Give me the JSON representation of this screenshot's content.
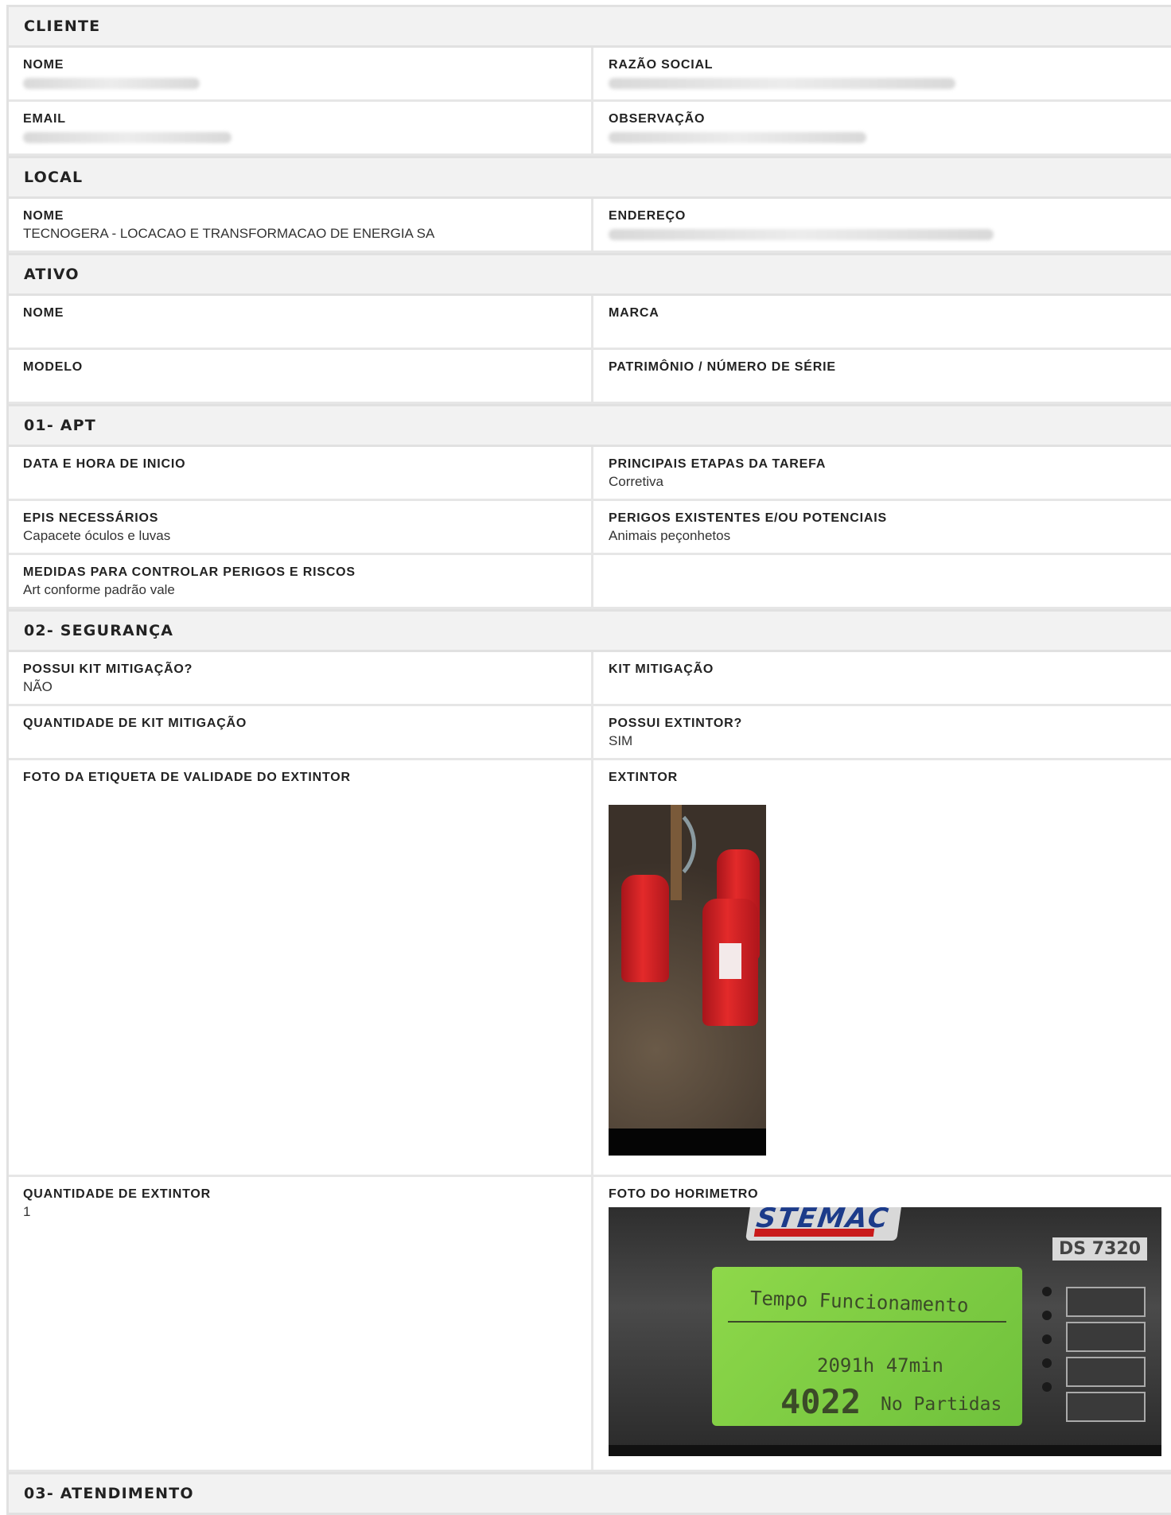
{
  "sections": {
    "cliente": {
      "title": "CLIENTE",
      "nome_label": "NOME",
      "razao_label": "RAZÃO SOCIAL",
      "email_label": "EMAIL",
      "observacao_label": "OBSERVAÇÃO"
    },
    "local": {
      "title": "LOCAL",
      "nome_label": "NOME",
      "nome_value": "TECNOGERA - LOCACAO E TRANSFORMACAO DE ENERGIA SA",
      "endereco_label": "ENDEREÇO"
    },
    "ativo": {
      "title": "ATIVO",
      "nome_label": "NOME",
      "marca_label": "MARCA",
      "modelo_label": "MODELO",
      "patrimonio_label": "PATRIMÔNIO / NÚMERO DE SÉRIE"
    },
    "apt": {
      "title": "01- APT",
      "data_label": "DATA E HORA DE INICIO",
      "etapas_label": "PRINCIPAIS ETAPAS DA TAREFA",
      "etapas_value": "Corretiva",
      "epis_label": "EPIS NECESSÁRIOS",
      "epis_value": "Capacete óculos e luvas",
      "perigos_label": "PERIGOS EXISTENTES E/OU POTENCIAIS",
      "perigos_value": "Animais peçonhetos",
      "medidas_label": "MEDIDAS PARA CONTROLAR PERIGOS E RISCOS",
      "medidas_value": "Art conforme padrão vale"
    },
    "seguranca": {
      "title": "02- SEGURANÇA",
      "possui_kit_label": "POSSUI KIT MITIGAÇÃO?",
      "possui_kit_value": "NÃO",
      "kit_label": "KIT MITIGAÇÃO",
      "qtd_kit_label": "QUANTIDADE DE KIT MITIGAÇÃO",
      "possui_extintor_label": "POSSUI EXTINTOR?",
      "possui_extintor_value": "SIM",
      "foto_etiqueta_label": "FOTO DA ETIQUETA DE VALIDADE DO EXTINTOR",
      "extintor_label": "EXTINTOR",
      "qtd_extintor_label": "QUANTIDADE DE EXTINTOR",
      "qtd_extintor_value": "1",
      "foto_horimetro_label": "FOTO DO HORIMETRO",
      "horimetro_photo": {
        "brand": "STEMAC",
        "model": "DS 7320",
        "line1": "Tempo Funcionamento",
        "line2": "2091h 47min",
        "starts": "4022",
        "starts_label": "No Partidas"
      }
    },
    "atendimento": {
      "title": "03- ATENDIMENTO"
    }
  }
}
